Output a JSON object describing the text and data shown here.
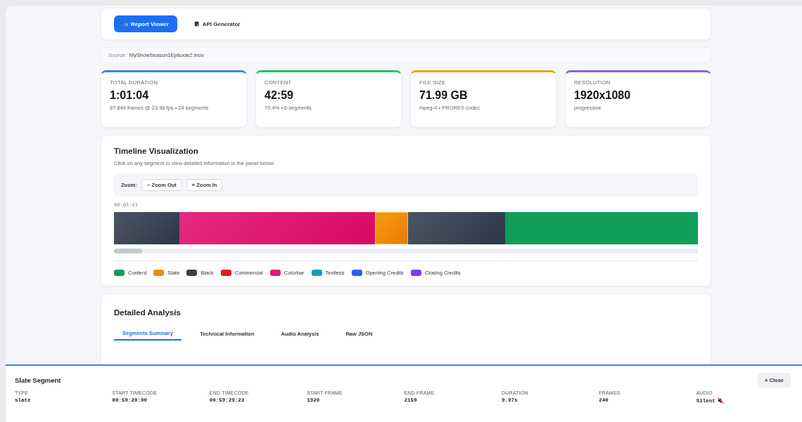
{
  "nav": {
    "buttons": [
      {
        "label": "Report Viewer",
        "selected": true
      },
      {
        "label": "API Generator",
        "selected": false
      }
    ]
  },
  "source": {
    "label": "Source:",
    "value": "MyShowSeason1Episode2.mov"
  },
  "stats": [
    {
      "label": "TOTAL DURATION",
      "value": "1:01:04",
      "detail": "87,849 frames @ 23.98 fps • 24 segments",
      "color": "#3b82f6"
    },
    {
      "label": "CONTENT",
      "value": "42:59",
      "detail": "70.4% • 6 segments",
      "color": "#22c55e"
    },
    {
      "label": "FILE SIZE",
      "value": "71.99 GB",
      "detail": "mpeg-4 • PRORES codec",
      "color": "#f59e0b"
    },
    {
      "label": "RESOLUTION",
      "value": "1920x1080",
      "detail": "progressive",
      "color": "#8b5cf6"
    }
  ],
  "timeline": {
    "title": "Timeline Visualization",
    "subtitle": "Click on any segment to view detailed information in the panel below",
    "zoom_label": "Zoom:",
    "zoom_buttons": [
      "− Zoom Out",
      "+ Zoom In"
    ],
    "timestamp": "00:03:43",
    "segments": [
      {
        "kind": "black",
        "selected": false
      },
      {
        "kind": "colorbar",
        "selected": false
      },
      {
        "kind": "slate",
        "selected": true
      },
      {
        "kind": "black",
        "selected": false
      },
      {
        "kind": "content",
        "selected": false
      }
    ],
    "legend": [
      {
        "label": "Content",
        "color": "#0f9d58"
      },
      {
        "label": "Slate",
        "color": "#f08a0c"
      },
      {
        "label": "Black",
        "color": "#374151"
      },
      {
        "label": "Commercial",
        "color": "#dc1f1f"
      },
      {
        "label": "Colorbar",
        "color": "#e11d74"
      },
      {
        "label": "Textless",
        "color": "#1a9bbd"
      },
      {
        "label": "Opening Credits",
        "color": "#2563eb"
      },
      {
        "label": "Closing Credits",
        "color": "#7c3aed"
      }
    ]
  },
  "analysis": {
    "title": "Detailed Analysis",
    "tabs": [
      {
        "label": "Segments Summary",
        "selected": true
      },
      {
        "label": "Technical Information",
        "selected": false
      },
      {
        "label": "Audio Analysis",
        "selected": false
      },
      {
        "label": "Raw JSON",
        "selected": false
      }
    ]
  },
  "panel": {
    "title": "Slate Segment",
    "close": "× Close",
    "fields": [
      {
        "label": "TYPE",
        "value": "slate"
      },
      {
        "label": "START TIMECODE",
        "value": "00:59:20:00"
      },
      {
        "label": "END TIMECODE",
        "value": "00:59:29:23"
      },
      {
        "label": "START FRAME",
        "value": "1920"
      },
      {
        "label": "END FRAME",
        "value": "2159"
      },
      {
        "label": "DURATION",
        "value": "9.97s"
      },
      {
        "label": "FRAMES",
        "value": "240"
      },
      {
        "label": "AUDIO",
        "value": "Silent",
        "muted": true
      }
    ]
  }
}
